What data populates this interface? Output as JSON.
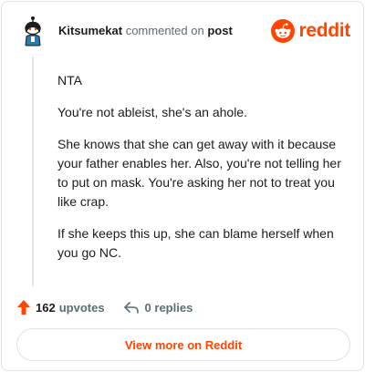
{
  "header": {
    "username": "Kitsumekat",
    "action_text": "commented on",
    "post_link": "post",
    "brand_name": "reddit",
    "brand_color": "#ff4500"
  },
  "comment": {
    "paragraphs": [
      "NTA",
      "You're not ableist, she's an ahole.",
      "She knows that she can get away with it because your father enables her. Also, you're not telling her to put on mask. You're asking her not to treat you like crap.",
      "If she keeps this up, she can blame herself when you go NC."
    ]
  },
  "actions": {
    "upvote_icon": "upvote-arrow-icon",
    "upvote_count": "162",
    "upvote_label": "upvotes",
    "reply_icon": "reply-arrow-icon",
    "replies_text": "0 replies"
  },
  "footer": {
    "view_more_label": "View more on Reddit"
  }
}
